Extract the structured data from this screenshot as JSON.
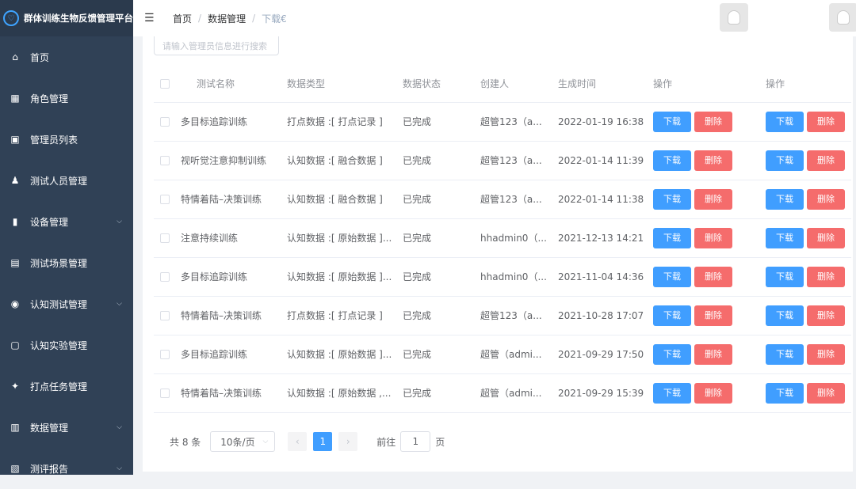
{
  "app": {
    "title": "群体训练生物反馈管理平台"
  },
  "sidebar": {
    "items": [
      {
        "label": "首页",
        "icon": "home-icon",
        "arrow": false
      },
      {
        "label": "角色管理",
        "icon": "grid-icon",
        "arrow": false
      },
      {
        "label": "管理员列表",
        "icon": "id-card-icon",
        "arrow": false
      },
      {
        "label": "测试人员管理",
        "icon": "users-icon",
        "arrow": false
      },
      {
        "label": "设备管理",
        "icon": "device-icon",
        "arrow": true
      },
      {
        "label": "测试场景管理",
        "icon": "scene-icon",
        "arrow": false
      },
      {
        "label": "认知测试管理",
        "icon": "location-icon",
        "arrow": true
      },
      {
        "label": "认知实验管理",
        "icon": "lab-icon",
        "arrow": false
      },
      {
        "label": "打点任务管理",
        "icon": "pin-icon",
        "arrow": false
      },
      {
        "label": "数据管理",
        "icon": "table-icon",
        "arrow": true
      },
      {
        "label": "测评报告",
        "icon": "report-icon",
        "arrow": true
      }
    ]
  },
  "breadcrumb": {
    "home": "首页",
    "section": "数据管理",
    "current": "下载€"
  },
  "search": {
    "placeholder": "请输入管理员信息进行搜索"
  },
  "table": {
    "headers": [
      "测试名称",
      "数据类型",
      "数据状态",
      "创建人",
      "生成时间",
      "操作",
      "操作"
    ],
    "download_label": "下载",
    "delete_label": "删除",
    "rows": [
      {
        "name": "多目标追踪训练",
        "type": "打点数据 :[ 打点记录 ]",
        "status": "已完成",
        "creator": "超管123（a...",
        "time": "2022-01-19 16:38"
      },
      {
        "name": "视听觉注意抑制训练",
        "type": "认知数据 :[ 融合数据 ]",
        "status": "已完成",
        "creator": "超管123（a...",
        "time": "2022-01-14 11:39"
      },
      {
        "name": "特情着陆–决策训练",
        "type": "认知数据 :[ 融合数据 ]",
        "status": "已完成",
        "creator": "超管123（a...",
        "time": "2022-01-14 11:38"
      },
      {
        "name": "注意持续训练",
        "type": "认知数据 :[ 原始数据 ]...",
        "status": "已完成",
        "creator": "hhadmin0（...",
        "time": "2021-12-13 14:21"
      },
      {
        "name": "多目标追踪训练",
        "type": "认知数据 :[ 原始数据 ]...",
        "status": "已完成",
        "creator": "hhadmin0（...",
        "time": "2021-11-04 14:36"
      },
      {
        "name": "特情着陆–决策训练",
        "type": "打点数据 :[ 打点记录 ]",
        "status": "已完成",
        "creator": "超管123（a...",
        "time": "2021-10-28 17:07"
      },
      {
        "name": "多目标追踪训练",
        "type": "认知数据 :[ 原始数据 ]...",
        "status": "已完成",
        "creator": "超管（admi...",
        "time": "2021-09-29 17:50"
      },
      {
        "name": "特情着陆–决策训练",
        "type": "认知数据 :[ 原始数据 ,...",
        "status": "已完成",
        "creator": "超管（admi...",
        "time": "2021-09-29 15:39"
      }
    ]
  },
  "pagination": {
    "total": "共 8 条",
    "page_size": "10条/页",
    "current_page": "1",
    "goto_label": "前往",
    "goto_value": "1",
    "page_suffix": "页"
  }
}
